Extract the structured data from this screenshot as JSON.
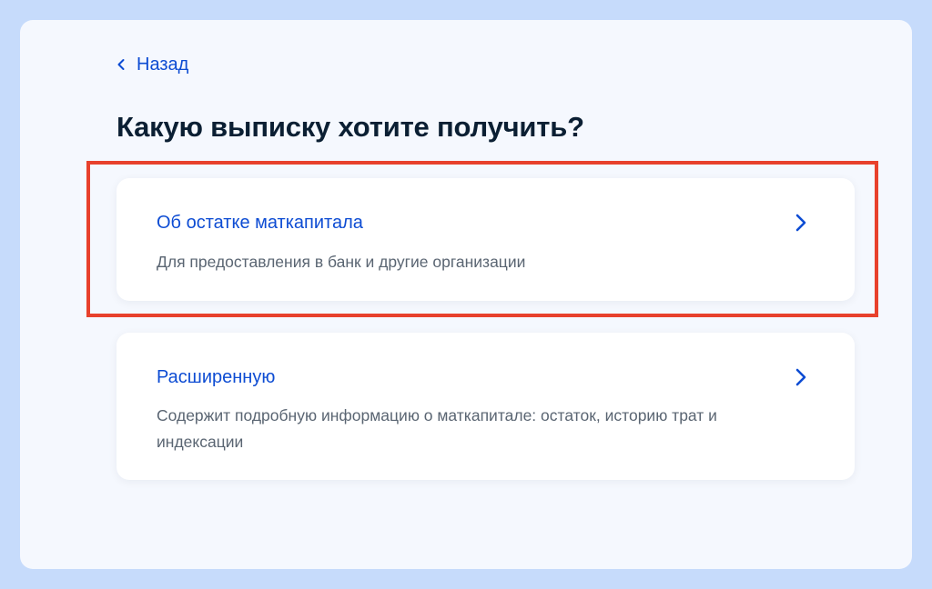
{
  "nav": {
    "back_label": "Назад"
  },
  "page": {
    "title": "Какую выписку хотите получить?"
  },
  "options": [
    {
      "title": "Об остатке маткапитала",
      "description": "Для предоставления в банк и другие организации"
    },
    {
      "title": "Расширенную",
      "description": "Содержит подробную информацию о маткапитале: остаток, историю трат и индексации"
    }
  ],
  "icons": {
    "back": "chevron-left-icon",
    "option_arrow": "chevron-right-icon"
  },
  "colors": {
    "outer_background": "#c6dbfb",
    "page_background": "#f5f8fe",
    "link_blue": "#0d4cd3",
    "title_text": "#0b1f33",
    "secondary_text": "#5a6572",
    "highlight_red": "#e8412c"
  }
}
